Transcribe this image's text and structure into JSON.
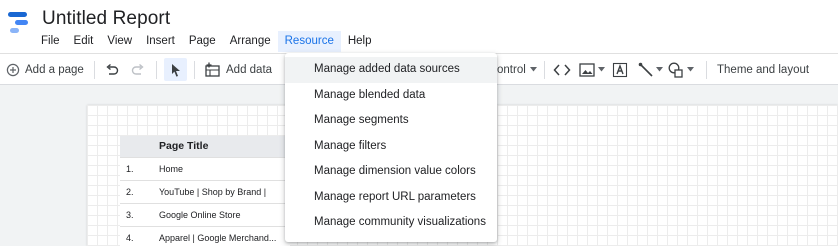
{
  "app": {
    "title": "Untitled Report"
  },
  "menu": [
    {
      "label": "File"
    },
    {
      "label": "Edit"
    },
    {
      "label": "View"
    },
    {
      "label": "Insert"
    },
    {
      "label": "Page"
    },
    {
      "label": "Arrange"
    },
    {
      "label": "Resource",
      "active": true
    },
    {
      "label": "Help"
    }
  ],
  "toolbar": {
    "add_page_label": "Add a page",
    "add_data_label": "Add data",
    "control_label": "ontrol",
    "theme_label": "Theme and layout"
  },
  "resource_menu": {
    "items": [
      "Manage added data sources",
      "Manage blended data",
      "Manage segments",
      "Manage filters",
      "Manage dimension value colors",
      "Manage report URL parameters",
      "Manage community visualizations"
    ]
  },
  "table": {
    "header": "Page Title",
    "rows": [
      {
        "index": "1.",
        "name": "Home"
      },
      {
        "index": "2.",
        "name": "YouTube | Shop by Brand |"
      },
      {
        "index": "3.",
        "name": "Google Online Store"
      },
      {
        "index": "4.",
        "name": "Apparel | Google Merchand..."
      }
    ]
  },
  "colors": {
    "accent": "#1a73e8",
    "active_menu_bg": "#e8f0fe",
    "logo_blue_dark": "#1967d2",
    "logo_blue_mid": "#4285f4",
    "logo_blue_light": "#8ab4f8"
  },
  "icons": {
    "logo": "data-studio-logo",
    "add_page": "add-circle-icon",
    "undo": "undo-icon",
    "redo": "redo-icon",
    "select": "cursor-arrow-icon",
    "add_data": "add-data-icon",
    "code": "code-brackets-icon",
    "image": "image-icon",
    "text": "text-box-icon",
    "line": "line-icon",
    "shape": "shape-icon"
  }
}
